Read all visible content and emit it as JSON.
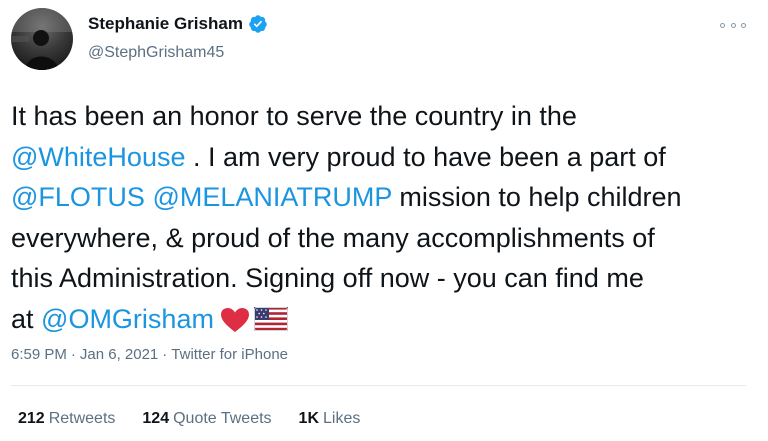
{
  "author": {
    "display_name": "Stephanie Grisham",
    "handle": "@StephGrisham45",
    "verified": true
  },
  "tweet": {
    "lines": [
      [
        {
          "text": "It has been an honor to serve the country in the",
          "type": "text"
        }
      ],
      [
        {
          "text": "@WhiteHouse",
          "type": "mention"
        },
        {
          "text": " . I am very proud to have been a part of",
          "type": "text"
        }
      ],
      [
        {
          "text": "@FLOTUS",
          "type": "mention"
        },
        {
          "text": " ",
          "type": "text"
        },
        {
          "text": "@MELANIATRUMP",
          "type": "mention"
        },
        {
          "text": " mission to help children",
          "type": "text"
        }
      ],
      [
        {
          "text": "everywhere, & proud of the many accomplishments of",
          "type": "text"
        }
      ],
      [
        {
          "text": "this Administration. Signing off now - you can find me",
          "type": "text"
        }
      ],
      [
        {
          "text": "at ",
          "type": "text"
        },
        {
          "text": "@OMGrisham",
          "type": "mention"
        }
      ]
    ],
    "emoji": [
      "red-heart",
      "us-flag"
    ]
  },
  "meta": {
    "time": "6:59 PM",
    "date": "Jan 6, 2021",
    "source": "Twitter for iPhone",
    "separator": "·"
  },
  "stats": {
    "retweets_count": "212",
    "retweets_label": "Retweets",
    "quote_count": "124",
    "quote_label": "Quote Tweets",
    "likes_count": "1K",
    "likes_label": "Likes"
  },
  "colors": {
    "link": "#1b95e0",
    "secondary_text": "#5b7083",
    "verified_badge": "#1da1f2",
    "heart": "#dd2e44"
  }
}
